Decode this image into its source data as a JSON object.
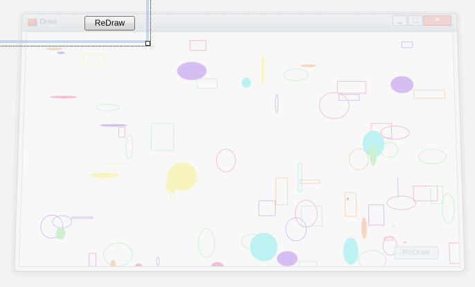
{
  "window": {
    "title": "Draw",
    "minimize_glyph": "▁",
    "maximize_glyph": "□",
    "close_glyph": "✕"
  },
  "toolbar": {
    "redraw_label": "ReDraw"
  },
  "ghost_canvas": {
    "redraw_label": "ReDraw"
  },
  "colors": {
    "purple": "#c9a6f0",
    "pink": "#f3a6c6",
    "yellow": "#f7f3a6",
    "cyan": "#a6f0f0",
    "green": "#bdeebd",
    "orange": "#f3caa6",
    "blue": "#b6b6ee"
  }
}
